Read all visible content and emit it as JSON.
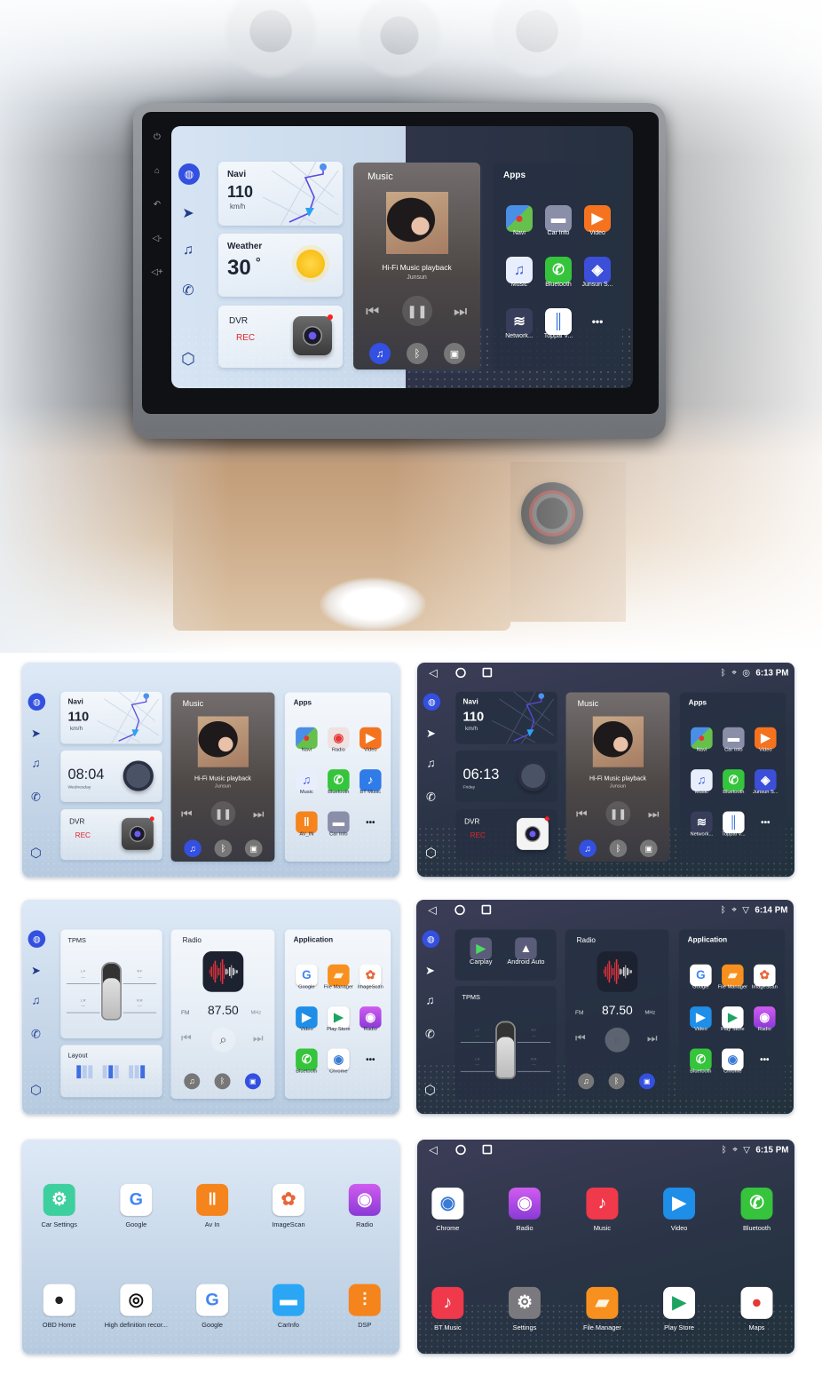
{
  "colors": {
    "accent_blue": "#3350e0",
    "rec_red": "#e0262b",
    "light_bg": "#dde9f6",
    "dark_bg": "#2a3446"
  },
  "head_unit_buttons": [
    "power-icon",
    "home-icon",
    "back-icon",
    "volume-down-icon",
    "volume-up-icon"
  ],
  "screens": [
    {
      "theme": "split",
      "type": "home1",
      "sidebar": [
        "microphone-icon",
        "navigation-icon",
        "music-note-icon",
        "phone-icon",
        "cube-icon"
      ],
      "navi": {
        "title": "Navi",
        "speed": "110",
        "unit": "km/h"
      },
      "widget": {
        "type": "weather",
        "title": "Weather",
        "value": "30",
        "unit": "°"
      },
      "dvr": {
        "title": "DVR",
        "status": "REC"
      },
      "music": {
        "title": "Music",
        "song": "Hi-Fi Music playback",
        "artist": "Junsun"
      },
      "apps": {
        "title": "Apps",
        "items": [
          {
            "label": "Navi",
            "icon": "navi"
          },
          {
            "label": "Car Info",
            "icon": "car-info"
          },
          {
            "label": "Video",
            "icon": "video"
          },
          {
            "label": "Music",
            "icon": "music"
          },
          {
            "label": "Bluetooth",
            "icon": "bluetooth-phone"
          },
          {
            "label": "Junsun S...",
            "icon": "junsun"
          },
          {
            "label": "Network...",
            "icon": "network-fm"
          },
          {
            "label": "Toppal V...",
            "icon": "toppal"
          },
          {
            "label": "",
            "icon": "more"
          }
        ]
      }
    },
    {
      "theme": "light",
      "type": "home1",
      "sidebar": [
        "microphone-icon",
        "navigation-icon",
        "music-note-icon",
        "phone-icon",
        "cube-icon"
      ],
      "navi": {
        "title": "Navi",
        "speed": "110",
        "unit": "km/h"
      },
      "widget": {
        "type": "clock",
        "value": "08:04",
        "day": "Wednesday"
      },
      "dvr": {
        "title": "DVR",
        "status": "REC"
      },
      "music": {
        "title": "Music",
        "song": "Hi-Fi Music playback",
        "artist": "Junsun"
      },
      "apps": {
        "title": "Apps",
        "items": [
          {
            "label": "Navi",
            "icon": "navi"
          },
          {
            "label": "Radio",
            "icon": "radio-red"
          },
          {
            "label": "Video",
            "icon": "video"
          },
          {
            "label": "Music",
            "icon": "music"
          },
          {
            "label": "Bluetooth",
            "icon": "bluetooth-phone"
          },
          {
            "label": "BT Music",
            "icon": "bt-music-blue"
          },
          {
            "label": "AV_IN",
            "icon": "av-in"
          },
          {
            "label": "Car Info",
            "icon": "car-info"
          },
          {
            "label": "",
            "icon": "more"
          }
        ]
      }
    },
    {
      "theme": "dark",
      "type": "home1",
      "status_bar": {
        "time": "6:13 PM",
        "icons": [
          "bluetooth-icon",
          "location-icon",
          "hotspot-icon"
        ]
      },
      "sidebar": [
        "microphone-icon",
        "navigation-icon",
        "music-note-icon",
        "phone-icon",
        "cube-icon"
      ],
      "navi": {
        "title": "Navi",
        "speed": "110",
        "unit": "km/h"
      },
      "widget": {
        "type": "clock",
        "value": "06:13",
        "day": "Friday"
      },
      "dvr": {
        "title": "DVR",
        "status": "REC"
      },
      "music": {
        "title": "Music",
        "song": "Hi-Fi Music playback",
        "artist": "Junsun"
      },
      "apps": {
        "title": "Apps",
        "items": [
          {
            "label": "Navi",
            "icon": "navi"
          },
          {
            "label": "Car Info",
            "icon": "car-info"
          },
          {
            "label": "Video",
            "icon": "video"
          },
          {
            "label": "Music",
            "icon": "music"
          },
          {
            "label": "Bluetooth",
            "icon": "bluetooth-phone"
          },
          {
            "label": "Junsun S...",
            "icon": "junsun"
          },
          {
            "label": "Network...",
            "icon": "network-fm"
          },
          {
            "label": "Toppal V...",
            "icon": "toppal"
          },
          {
            "label": "",
            "icon": "more"
          }
        ]
      }
    },
    {
      "theme": "light",
      "type": "home2",
      "sidebar": [
        "microphone-icon",
        "navigation-icon",
        "music-note-icon",
        "phone-icon",
        "cube-icon"
      ],
      "tpms": {
        "title": "TPMS",
        "tires": [
          {
            "pos": "L.F",
            "value": "---"
          },
          {
            "pos": "R.F",
            "value": "---"
          },
          {
            "pos": "L.R",
            "value": "---"
          },
          {
            "pos": "R.R",
            "value": "---"
          }
        ]
      },
      "layout": {
        "title": "Layout"
      },
      "radio": {
        "title": "Radio",
        "band": "FM",
        "freq": "87.50",
        "unit": "MHz"
      },
      "apps": {
        "title": "Application",
        "items": [
          {
            "label": "Google",
            "icon": "google"
          },
          {
            "label": "File Manager",
            "icon": "file-manager"
          },
          {
            "label": "ImageScan",
            "icon": "imagescan"
          },
          {
            "label": "Video",
            "icon": "video-blue"
          },
          {
            "label": "Play Store",
            "icon": "play-store"
          },
          {
            "label": "Radio",
            "icon": "radio-purple"
          },
          {
            "label": "Bluetooth",
            "icon": "bluetooth-phone"
          },
          {
            "label": "Chrome",
            "icon": "chrome"
          },
          {
            "label": "",
            "icon": "more"
          }
        ]
      }
    },
    {
      "theme": "dark",
      "type": "home2",
      "status_bar": {
        "time": "6:14 PM",
        "icons": [
          "bluetooth-icon",
          "location-icon",
          "wifi-icon"
        ]
      },
      "sidebar": [
        "microphone-icon",
        "navigation-icon",
        "music-note-icon",
        "phone-icon",
        "cube-icon"
      ],
      "projection": [
        {
          "label": "Carplay",
          "icon": "carplay"
        },
        {
          "label": "Android Auto",
          "icon": "android-auto"
        }
      ],
      "tpms": {
        "title": "TPMS",
        "tires": [
          {
            "pos": "L.F",
            "value": "---"
          },
          {
            "pos": "R.F",
            "value": "---"
          },
          {
            "pos": "L.R",
            "value": "---"
          },
          {
            "pos": "R.R",
            "value": "---"
          }
        ]
      },
      "radio": {
        "title": "Radio",
        "band": "FM",
        "freq": "87.50",
        "unit": "MHz"
      },
      "apps": {
        "title": "Application",
        "items": [
          {
            "label": "Google",
            "icon": "google"
          },
          {
            "label": "File Manager",
            "icon": "file-manager"
          },
          {
            "label": "ImageScan",
            "icon": "imagescan"
          },
          {
            "label": "Video",
            "icon": "video-blue"
          },
          {
            "label": "Play Store",
            "icon": "play-store"
          },
          {
            "label": "Radio",
            "icon": "radio-purple"
          },
          {
            "label": "Bluetooth",
            "icon": "bluetooth-phone"
          },
          {
            "label": "Chrome",
            "icon": "chrome"
          },
          {
            "label": "",
            "icon": "more"
          }
        ]
      }
    },
    {
      "theme": "light",
      "type": "grid",
      "apps": {
        "items": [
          {
            "label": "Car Settings",
            "icon": "car-settings"
          },
          {
            "label": "Google",
            "icon": "google"
          },
          {
            "label": "Av In",
            "icon": "av-in"
          },
          {
            "label": "ImageScan",
            "icon": "imagescan"
          },
          {
            "label": "Radio",
            "icon": "radio-purple"
          },
          {
            "label": "OBD Home",
            "icon": "obd"
          },
          {
            "label": "High definition recor...",
            "icon": "hd-recorder"
          },
          {
            "label": "Google",
            "icon": "google"
          },
          {
            "label": "CarInfo",
            "icon": "carinfo-blue"
          },
          {
            "label": "DSP",
            "icon": "dsp"
          }
        ]
      }
    },
    {
      "theme": "dark",
      "type": "grid",
      "status_bar": {
        "time": "6:15 PM",
        "icons": [
          "bluetooth-icon",
          "location-icon",
          "wifi-icon"
        ]
      },
      "apps": {
        "items": [
          {
            "label": "Chrome",
            "icon": "chrome"
          },
          {
            "label": "Radio",
            "icon": "radio-purple"
          },
          {
            "label": "Music",
            "icon": "music-red"
          },
          {
            "label": "Video",
            "icon": "video-blue"
          },
          {
            "label": "Bluetooth",
            "icon": "bluetooth-phone"
          },
          {
            "label": "BT Music",
            "icon": "bt-music-red"
          },
          {
            "label": "Settings",
            "icon": "settings"
          },
          {
            "label": "File Manager",
            "icon": "file-manager"
          },
          {
            "label": "Play Store",
            "icon": "play-store"
          },
          {
            "label": "Maps",
            "icon": "maps"
          }
        ]
      }
    }
  ]
}
